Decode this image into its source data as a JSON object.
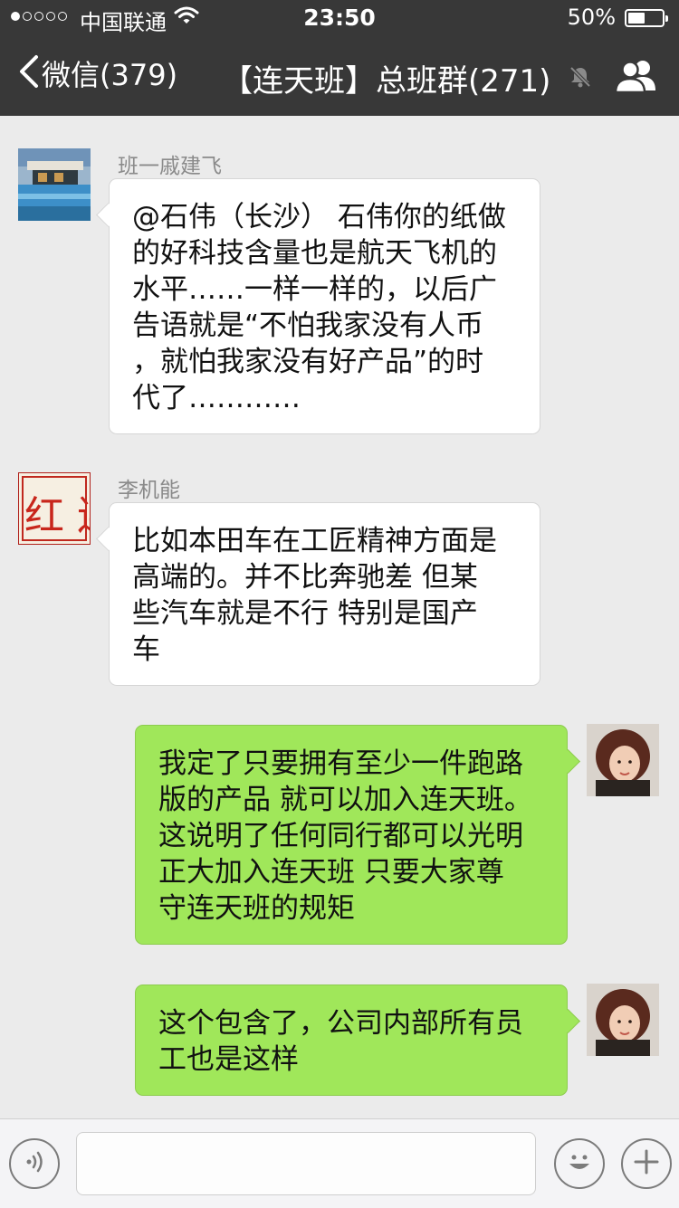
{
  "status_bar": {
    "carrier": "中国联通",
    "time": "23:50",
    "battery_percent_label": "50%",
    "battery_level": 0.5,
    "signal_bars_filled": 1,
    "signal_bars_total": 5
  },
  "nav": {
    "back_label": "微信(379)",
    "title": "【连天班】总班群(271)",
    "icons": [
      "chevron-left-icon",
      "mute-bell-icon",
      "group-members-icon"
    ]
  },
  "messages": [
    {
      "direction": "incoming",
      "sender": "班一戚建飞",
      "lines": [
        "@石伟（长沙） 石伟你的纸做",
        "的好科技含量也是航天飞机的",
        "水平……一样一样的，以后广",
        "告语就是“不怕我家没有人币",
        "，就怕我家没有好产品”的时",
        "代了…………"
      ]
    },
    {
      "direction": "incoming",
      "sender": "李机能",
      "avatar_text": "红 连天",
      "lines": [
        "比如本田车在工匠精神方面是",
        "高端的。并不比奔驰差  但某",
        "些汽车就是不行  特别是国产",
        "车"
      ]
    },
    {
      "direction": "outgoing",
      "lines": [
        "我定了只要拥有至少一件跑路",
        "版的产品 就可以加入连天班。",
        "这说明了任何同行都可以光明",
        "正大加入连天班  只要大家尊",
        "守连天班的规矩"
      ]
    },
    {
      "direction": "outgoing",
      "lines": [
        "这个包含了，公司内部所有员",
        "工也是这样"
      ]
    }
  ],
  "input_bar": {
    "icons": [
      "voice-icon",
      "emoji-icon",
      "plus-icon"
    ],
    "input_value": ""
  },
  "colors": {
    "nav_bg": "#383838",
    "chat_bg": "#ebebeb",
    "incoming_bubble": "#ffffff",
    "outgoing_bubble": "#a0e75a"
  }
}
